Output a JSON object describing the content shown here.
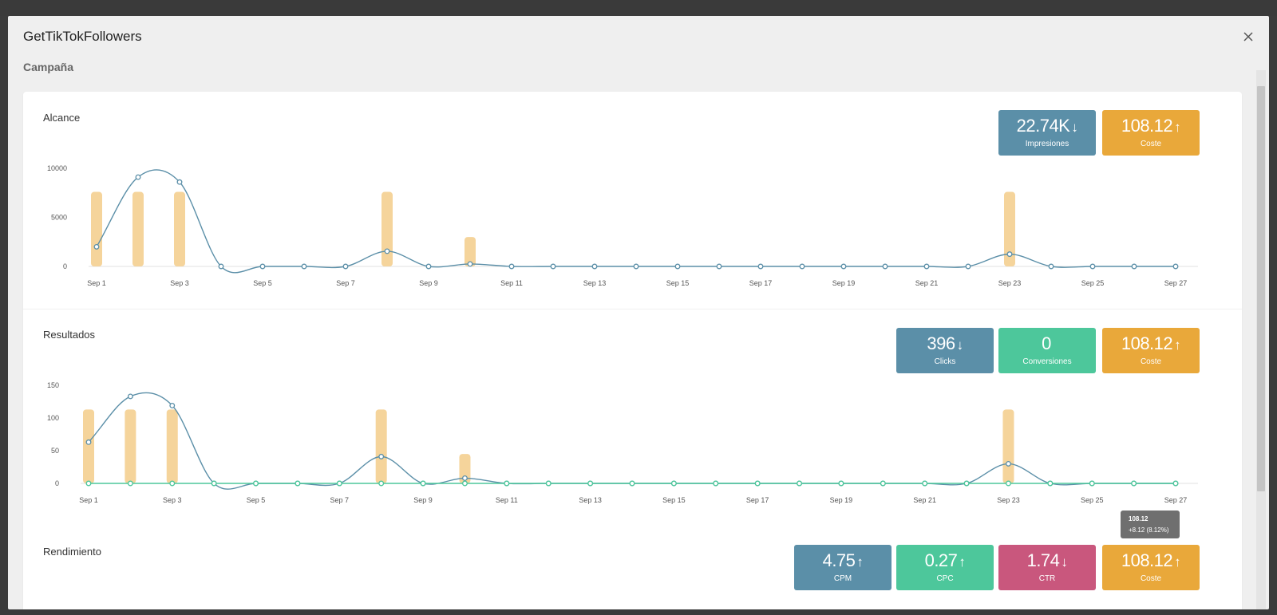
{
  "window": {
    "title": "GetTikTokFollowers"
  },
  "section": {
    "heading": "Campaña"
  },
  "colors": {
    "blue": "#5b8fa8",
    "green": "#4dc79b",
    "orange": "#e9a83a",
    "pink": "#c9577d",
    "bar": "#f5d49b",
    "line": "#5b8fa8"
  },
  "panels": {
    "alcance": {
      "title": "Alcance",
      "metrics": [
        {
          "value": "22.74K",
          "arrow": "↓",
          "label": "Impresiones",
          "color": "#5b8fa8"
        },
        {
          "value": "108.12",
          "arrow": "↑",
          "label": "Coste",
          "color": "#e9a83a"
        }
      ]
    },
    "resultados": {
      "title": "Resultados",
      "metrics": [
        {
          "value": "396",
          "arrow": "↓",
          "label": "Clicks",
          "color": "#5b8fa8"
        },
        {
          "value": "0",
          "arrow": "",
          "label": "Conversiones",
          "color": "#4dc79b"
        },
        {
          "value": "108.12",
          "arrow": "↑",
          "label": "Coste",
          "color": "#e9a83a"
        }
      ]
    },
    "rendimiento": {
      "title": "Rendimiento",
      "metrics": [
        {
          "value": "4.75",
          "arrow": "↑",
          "label": "CPM",
          "color": "#5b8fa8"
        },
        {
          "value": "0.27",
          "arrow": "↑",
          "label": "CPC",
          "color": "#4dc79b"
        },
        {
          "value": "1.74",
          "arrow": "↓",
          "label": "CTR",
          "color": "#c9577d"
        },
        {
          "value": "108.12",
          "arrow": "↑",
          "label": "Coste",
          "color": "#e9a83a"
        }
      ]
    }
  },
  "tooltip": {
    "value": "108.12",
    "change": "+8.12 (8.12%)"
  },
  "chart_data": [
    {
      "type": "line",
      "panel": "Alcance",
      "x": [
        "Sep 1",
        "Sep 2",
        "Sep 3",
        "Sep 4",
        "Sep 5",
        "Sep 6",
        "Sep 7",
        "Sep 8",
        "Sep 9",
        "Sep 10",
        "Sep 11",
        "Sep 12",
        "Sep 13",
        "Sep 14",
        "Sep 15",
        "Sep 16",
        "Sep 17",
        "Sep 18",
        "Sep 19",
        "Sep 20",
        "Sep 21",
        "Sep 22",
        "Sep 23",
        "Sep 24",
        "Sep 25",
        "Sep 26",
        "Sep 27"
      ],
      "x_tick_labels": [
        "Sep 1",
        "Sep 3",
        "Sep 5",
        "Sep 7",
        "Sep 9",
        "Sep 11",
        "Sep 13",
        "Sep 15",
        "Sep 17",
        "Sep 19",
        "Sep 21",
        "Sep 23",
        "Sep 25",
        "Sep 27"
      ],
      "y_ticks": [
        0,
        5000,
        10000
      ],
      "ylim": [
        0,
        10000
      ],
      "series": [
        {
          "kind": "bar",
          "color": "#f5d49b",
          "values": [
            7600,
            7600,
            7600,
            0,
            0,
            0,
            0,
            7600,
            0,
            3000,
            0,
            0,
            0,
            0,
            0,
            0,
            0,
            0,
            0,
            0,
            0,
            0,
            7600,
            0,
            0,
            0,
            0
          ]
        },
        {
          "kind": "line",
          "color": "#5b8fa8",
          "values": [
            2000,
            9100,
            8600,
            0,
            0,
            0,
            0,
            1550,
            0,
            250,
            0,
            0,
            0,
            0,
            0,
            0,
            0,
            0,
            0,
            0,
            0,
            0,
            1250,
            0,
            0,
            0,
            0
          ]
        }
      ]
    },
    {
      "type": "line",
      "panel": "Resultados",
      "x": [
        "Sep 1",
        "Sep 2",
        "Sep 3",
        "Sep 4",
        "Sep 5",
        "Sep 6",
        "Sep 7",
        "Sep 8",
        "Sep 9",
        "Sep 10",
        "Sep 11",
        "Sep 12",
        "Sep 13",
        "Sep 14",
        "Sep 15",
        "Sep 16",
        "Sep 17",
        "Sep 18",
        "Sep 19",
        "Sep 20",
        "Sep 21",
        "Sep 22",
        "Sep 23",
        "Sep 24",
        "Sep 25",
        "Sep 26",
        "Sep 27"
      ],
      "x_tick_labels": [
        "Sep 1",
        "Sep 3",
        "Sep 5",
        "Sep 7",
        "Sep 9",
        "Sep 11",
        "Sep 13",
        "Sep 15",
        "Sep 17",
        "Sep 19",
        "Sep 21",
        "Sep 23",
        "Sep 25",
        "Sep 27"
      ],
      "y_ticks": [
        0,
        50,
        100,
        150
      ],
      "ylim": [
        0,
        150
      ],
      "series": [
        {
          "kind": "bar",
          "color": "#f5d49b",
          "values": [
            113,
            113,
            113,
            0,
            0,
            0,
            0,
            113,
            0,
            45,
            0,
            0,
            0,
            0,
            0,
            0,
            0,
            0,
            0,
            0,
            0,
            0,
            113,
            0,
            0,
            0,
            0
          ]
        },
        {
          "kind": "line",
          "color": "#5b8fa8",
          "values": [
            63,
            133,
            119,
            0,
            0,
            0,
            0,
            41,
            0,
            8,
            0,
            0,
            0,
            0,
            0,
            0,
            0,
            0,
            0,
            0,
            0,
            0,
            30,
            0,
            0,
            0,
            0
          ]
        },
        {
          "kind": "line",
          "color": "#4dc79b",
          "values": [
            0,
            0,
            0,
            0,
            0,
            0,
            0,
            0,
            0,
            0,
            0,
            0,
            0,
            0,
            0,
            0,
            0,
            0,
            0,
            0,
            0,
            0,
            0,
            0,
            0,
            0,
            0
          ]
        }
      ]
    }
  ]
}
